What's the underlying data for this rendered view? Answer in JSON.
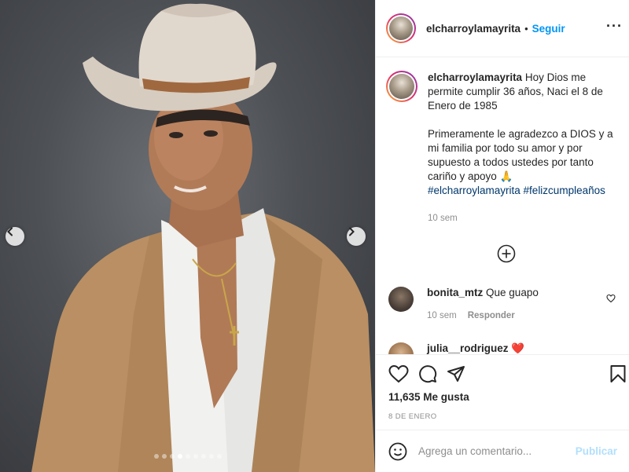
{
  "post": {
    "username": "elcharroylamayrita",
    "separator": "•",
    "follow_label": "Seguir",
    "more_icon": "more-options-icon",
    "media": {
      "slide_count": 9,
      "active_slide": 3,
      "prev_icon": "chevron-left-icon",
      "next_icon": "chevron-right-icon"
    },
    "caption": {
      "username": "elcharroylamayrita",
      "text_1": "Hoy Dios me permite cumplir 36 años, Naci el 8 de Enero de 1985",
      "text_2": "Primeramente le agradezco a DIOS y a mi familia por todo su amor y por supuesto a todos ustedes por tanto cariño y apoyo 🙏",
      "hashtags": "#elcharroylamayrita #felizcumpleaños",
      "time": "10 sem"
    },
    "load_more_icon": "plus-circle-icon",
    "comments": [
      {
        "username": "bonita_mtz",
        "text": "Que guapo",
        "time": "10 sem",
        "reply_label": "Responder"
      },
      {
        "username": "julia__rodriguez",
        "text": "❤️"
      }
    ],
    "actions": {
      "like_icon": "heart-icon",
      "comment_icon": "comment-icon",
      "share_icon": "paper-plane-icon",
      "save_icon": "bookmark-icon"
    },
    "likes_label": "11,635 Me gusta",
    "date_label": "8 DE ENERO",
    "add_comment": {
      "placeholder": "Agrega un comentario...",
      "emoji_icon": "emoji-icon",
      "publish_label": "Publicar"
    },
    "colors": {
      "link_blue": "#0095f6",
      "hashtag_blue": "#00376b",
      "muted": "#8e8e8e",
      "publish_disabled": "#b2dffc",
      "heart_red": "#ed4956"
    }
  }
}
